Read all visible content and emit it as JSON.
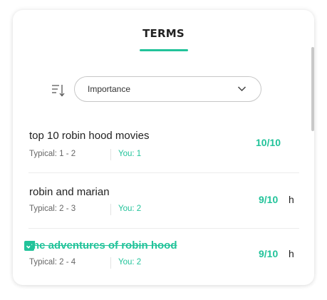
{
  "header": {
    "title": "TERMS"
  },
  "sort": {
    "icon": "sort-icon",
    "selected": "Importance"
  },
  "terms": [
    {
      "text": "top 10 robin hood movies",
      "typical": "Typical: 1 - 2",
      "you": "You: 1",
      "score": "10/10",
      "suffix": "",
      "checked": false
    },
    {
      "text": "robin and marian",
      "typical": "Typical: 2 - 3",
      "you": "You: 2",
      "score": "9/10",
      "suffix": "h",
      "checked": false
    },
    {
      "text": "the adventures of robin hood",
      "typical": "Typical: 2 - 4",
      "you": "You: 2",
      "score": "9/10",
      "suffix": "h",
      "checked": true
    }
  ],
  "colors": {
    "accent": "#22c39a",
    "text": "#222222",
    "muted": "#666666",
    "border": "#c7c7c7"
  }
}
